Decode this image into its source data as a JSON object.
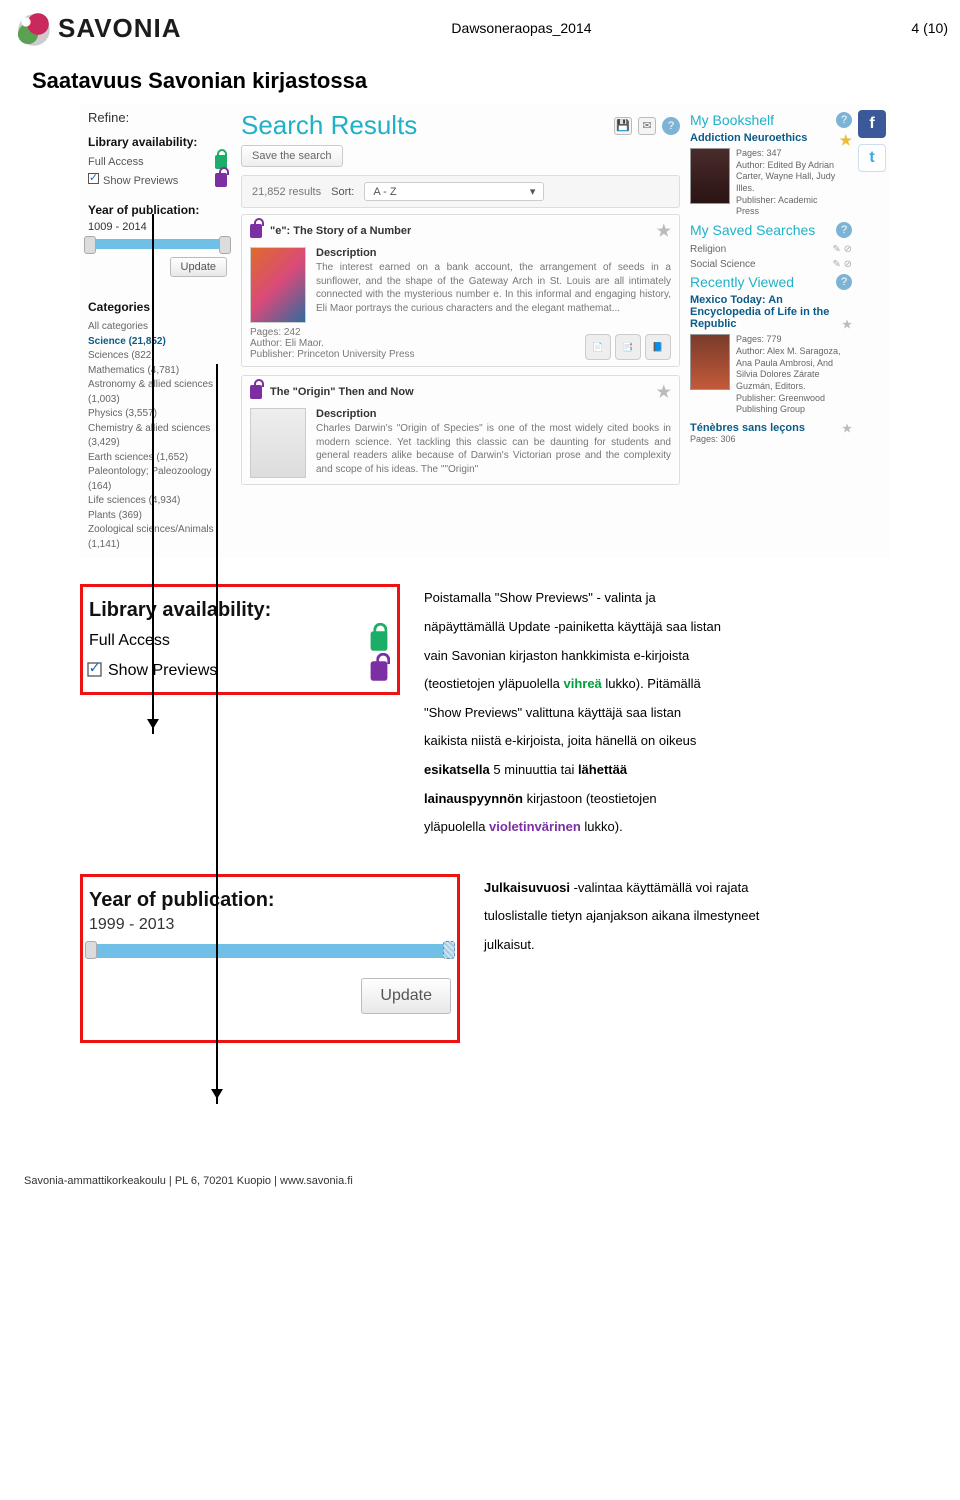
{
  "header": {
    "logo_text": "SAVONIA",
    "doc_title": "Dawsoneraopas_2014",
    "page_num": "4 (10)"
  },
  "section_heading": "Saatavuus Savonian kirjastossa",
  "refine": {
    "title": "Refine:",
    "lib_head": "Library availability:",
    "full_access": "Full Access",
    "show_previews": "Show Previews",
    "year_head": "Year of publication:",
    "year_range": "1009 - 2014",
    "update_label": "Update",
    "cat_head": "Categories",
    "cats": [
      "All categories",
      "Science (21,852)",
      "Sciences (822)",
      "Mathematics (4,781)",
      "Astronomy & allied sciences (1,003)",
      "Physics (3,557)",
      "Chemistry & allied sciences (3,429)",
      "Earth sciences (1,652)",
      "Paleontology; Paleozoology (164)",
      "Life sciences (4,934)",
      "Plants (369)",
      "Zoological sciences/Animals (1,141)"
    ]
  },
  "main": {
    "sr_title": "Search Results",
    "save_search": "Save the search",
    "count": "21,852 results",
    "sort_label": "Sort:",
    "sort_value": "A - Z",
    "card1": {
      "title": "\"e\": The Story of a Number",
      "desc_h": "Description",
      "desc": "The interest earned on a bank account, the arrangement of seeds in a sunflower, and the shape of the Gateway Arch in St. Louis are all intimately connected with the mysterious number e. In this informal and engaging history, Eli Maor portrays the curious characters and the elegant mathemat...",
      "pages": "Pages: 242",
      "author": "Author: Eli Maor.",
      "publisher": "Publisher: Princeton University Press"
    },
    "card2": {
      "title": "The \"Origin\" Then and Now",
      "desc_h": "Description",
      "desc": "Charles Darwin's \"Origin of Species\" is one of the most widely cited books in modern science. Yet tackling this classic can be daunting for students and general readers alike because of Darwin's Victorian prose and the complexity and scope of his ideas. The \"\"Origin\""
    }
  },
  "right": {
    "bookshelf": "My Bookshelf",
    "book1": {
      "title": "Addiction Neuroethics",
      "pages": "Pages: 347",
      "author": "Author: Edited By Adrian Carter, Wayne Hall, Judy Illes.",
      "publisher": "Publisher: Academic Press"
    },
    "saved": "My Saved Searches",
    "ss1": "Religion",
    "ss2": "Social Science",
    "recent": "Recently Viewed",
    "book2": {
      "title": "Mexico Today: An Encyclopedia of Life in the Republic",
      "pages": "Pages: 779",
      "author": "Author: Alex M. Saragoza, Ana Paula Ambrosi, And Silvia Dolores Zárate Guzmán, Editors.",
      "publisher": "Publisher: Greenwood Publishing Group"
    },
    "book3": {
      "title": "Ténèbres sans leçons",
      "pages": "Pages: 306"
    }
  },
  "callout_lib": {
    "head": "Library availability:",
    "full_access": "Full Access",
    "show_previews": "Show Previews"
  },
  "text1": {
    "l1": "Poistamalla \"Show Previews\" - valinta ja",
    "l2": "näpäyttämällä Update -painiketta käyttäjä saa listan",
    "l3": "vain Savonian kirjaston hankkimista e-kirjoista",
    "l4a": "(teostietojen yläpuolella ",
    "l4b": "vihreä",
    "l4c": " lukko). Pitämällä",
    "l5": "\"Show Previews\" valittuna käyttäjä saa listan",
    "l6": "kaikista niistä e-kirjoista, joita hänellä on oikeus",
    "l7a": "esikatsella",
    "l7b": " 5 minuuttia tai ",
    "l7c": "lähettää",
    "l8a": "lainauspyynnön",
    "l8b": " kirjastoon (teostietojen",
    "l9a": "yläpuolella ",
    "l9b": "violetinvärinen",
    "l9c": " lukko)."
  },
  "callout_year": {
    "head": "Year of publication:",
    "range": "1999 - 2013",
    "update": "Update"
  },
  "text2": {
    "l1a": "Julkaisuvuosi ",
    "l1b": "-valintaa käyttämällä voi rajata",
    "l2": "tuloslistalle tietyn ajanjakson aikana ilmestyneet",
    "l3": "julkaisut."
  },
  "footer": "Savonia-ammattikorkeakoulu  |  PL 6, 70201 Kuopio  |  www.savonia.fi"
}
